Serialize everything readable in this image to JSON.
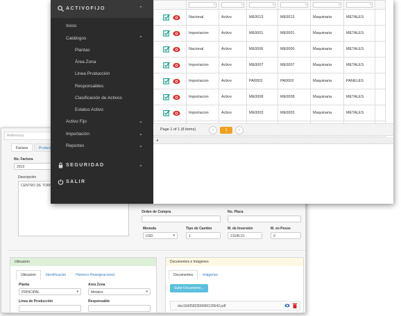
{
  "back": {
    "search_placeholder": "Referencia",
    "tabs": [
      "Factura",
      "Producto"
    ],
    "no_factura_label": "No. Factura",
    "no_factura_value": "2019",
    "descripcion_label": "Descripción",
    "descripcion_value": "CENTRO DE TORN",
    "orden_compra_label": "Orden de Compra",
    "no_placa_label": "No. Placa",
    "moneda_label": "Moneda",
    "moneda_value": "USD",
    "tipo_cambio_label": "Tipo de Cambio",
    "tipo_cambio_value": "1",
    "inversion_label": "M. de Inversión",
    "inversion_value": "21045.51",
    "pesos_label": "M. en Pesos",
    "pesos_value": "0",
    "ubicacion": {
      "title": "Ubicacion",
      "tabs": [
        "Ubicacion",
        "Identificacion",
        "Historico Reasignaciones"
      ],
      "planta_label": "Planta",
      "planta_value": "PRINCIPAL",
      "area_zona_label": "Area Zona",
      "area_zona_value": "Metales",
      "linea_label": "Linea de Producción",
      "responsable_label": "Responsable"
    },
    "documentos": {
      "title": "Documentos e Imágenes",
      "tabs": [
        "Documentos",
        "Imágenes"
      ],
      "upload_button": "Subir Documento...",
      "file_name": "doc1642582306666120642.pdf"
    }
  },
  "sidebar": {
    "activofijo": "ACTIVOFIJO",
    "items": [
      "Inicio",
      "Catálogos"
    ],
    "catalog_items": [
      "Plantas",
      "Área Zona",
      "Linea Producción",
      "Responsables",
      "Clasificación de Activos",
      "Estatus Activo"
    ],
    "menus": [
      "Activo Fijo",
      "Importación",
      "Reportes"
    ],
    "seguridad": "SEGURIDAD",
    "salir": "SALIR"
  },
  "grid": {
    "rows": [
      [
        "Nacional",
        "Activo",
        "ME0013",
        "ME0013",
        "Maquinaria",
        "METALES"
      ],
      [
        "Importacion",
        "Activo",
        "ME0001",
        "ME0001",
        "Maquinaria",
        "METALES"
      ],
      [
        "Nacional",
        "Activo",
        "ME0006",
        "ME0006",
        "Maquinaria",
        "METALES"
      ],
      [
        "Importacion",
        "Activo",
        "ME0007",
        "ME0007",
        "Maquinaria",
        "METALES"
      ],
      [
        "Importacion",
        "Activo",
        "PA0003",
        "PA0003",
        "Maquinaria",
        "PANELES"
      ],
      [
        "Importacion",
        "Activo",
        "ME0008",
        "ME0008",
        "Maquinaria",
        "METALES"
      ],
      [
        "Importacion",
        "Activo",
        "ME0003",
        "ME0003",
        "Maquinaria",
        "METALES"
      ],
      [
        "Importacion",
        "Activo",
        "ME0020",
        "ME0020",
        "Maquinaria",
        "METALES"
      ]
    ],
    "pager_info": "Page 1 of 1 (8 items)",
    "current_page": "1",
    "colors": {
      "edit": "#1aa58a",
      "view": "#e02020",
      "pager": "#f0a020"
    }
  }
}
